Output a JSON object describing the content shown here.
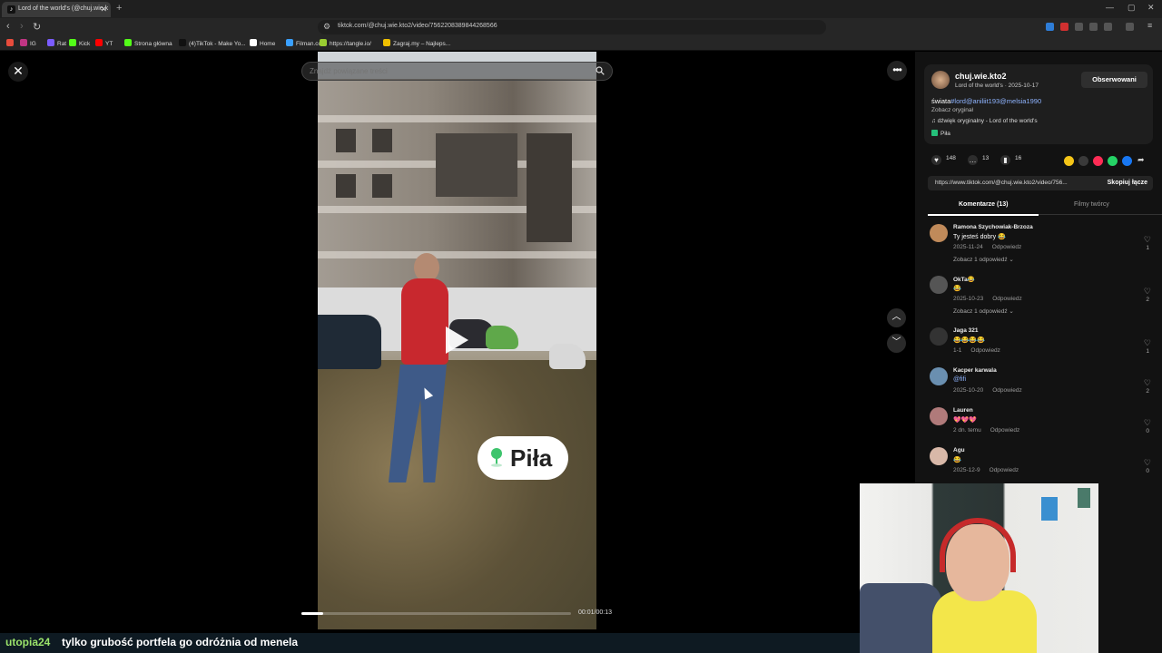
{
  "browser": {
    "tab_title": "Lord of the world's (@chuj.wie.k",
    "url": "tiktok.com/@chuj.wie.kto2/video/7562208389844268566",
    "bookmarks": [
      {
        "label": "",
        "color": "#e74c3c"
      },
      {
        "label": "IG",
        "color": "#c13584"
      },
      {
        "label": "Rat",
        "color": "#7b5cff"
      },
      {
        "label": "Kick",
        "color": "#53fc18"
      },
      {
        "label": "YT",
        "color": "#ff0000"
      },
      {
        "label": "Strona główna",
        "color": "#53fc18"
      },
      {
        "label": "(4)TikTok - Make Yo...",
        "color": "#111111"
      },
      {
        "label": "Home",
        "color": "#ffffff"
      },
      {
        "label": "Filman.cc",
        "color": "#3aa0ff"
      },
      {
        "label": "https://tangle.io/",
        "color": "#9acd32"
      },
      {
        "label": "Zagraj.my – Najleps...",
        "color": "#f0c000"
      }
    ]
  },
  "viewer": {
    "search_placeholder": "Znajdź powiązane treści",
    "location_sticker": "Piła",
    "timecode": "00:01/00:13",
    "progress": 0.08
  },
  "post": {
    "author": "chuj.wie.kto2",
    "author_sub": "Lord of the world's · 2025-10-17",
    "follow_label": "Obserwowani",
    "desc_prefix": "świata",
    "desc_tags": "#lord@aniliit193@melsia1990",
    "see_original": "Zobacz oryginał",
    "music": "♫  dźwięk oryginalny - Lord of the world's",
    "place": "Piła",
    "likes": "148",
    "comments": "13",
    "saves": "16",
    "share_colors": [
      "#f5c518",
      "#3a3a3a",
      "#fe2c55",
      "#25d366",
      "#1877f2"
    ],
    "link": "https://www.tiktok.com/@chuj.wie.kto2/video/756...",
    "copy_label": "Skopiuj łącze",
    "tab_comments": "Komentarze (13)",
    "tab_creator": "Filmy twórcy"
  },
  "comments": [
    {
      "name": "Ramona  Szychowiak-Brzoza",
      "text": "Ty jesteś dobry 😂",
      "date": "2025-11-24",
      "reply": "Odpowiedz",
      "more": "Zobacz 1 odpowiedź ⌄",
      "likes": "1",
      "color": "#c08a5a",
      "link": false
    },
    {
      "name": "OkTa😂",
      "text": "😂",
      "date": "2025-10-23",
      "reply": "Odpowiedz",
      "more": "Zobacz 1 odpowiedź ⌄",
      "likes": "2",
      "color": "#555555",
      "link": false
    },
    {
      "name": "Jaga 321",
      "text": "😂😂😂😂",
      "date": "1-1",
      "reply": "Odpowiedz",
      "more": "",
      "likes": "1",
      "color": "#333333",
      "link": false
    },
    {
      "name": "Kacper karwala",
      "text": "@fifi",
      "date": "2025-10-20",
      "reply": "Odpowiedz",
      "more": "",
      "likes": "2",
      "color": "#6a8fb0",
      "link": true
    },
    {
      "name": "Lauren",
      "text": "💖💖💖",
      "date": "2 dn. temu",
      "reply": "Odpowiedz",
      "more": "",
      "likes": "0",
      "color": "#b07a7a",
      "link": false
    },
    {
      "name": "Agu",
      "text": "😂",
      "date": "2025-12-9",
      "reply": "Odpowiedz",
      "more": "",
      "likes": "0",
      "color": "#d8b8a8",
      "link": false
    }
  ],
  "overlay": {
    "brand": "utopia24",
    "subtitle": "tylko grubość portfela go odróżnia od menela"
  }
}
